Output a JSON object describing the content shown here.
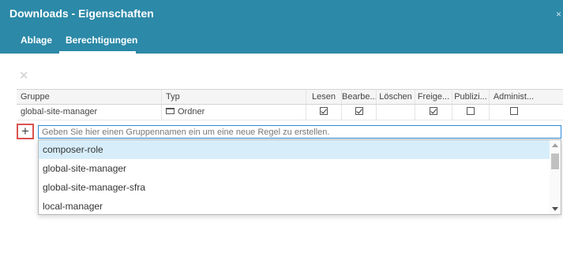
{
  "dialog": {
    "title": "Downloads - Eigenschaften",
    "close_symbol": "×",
    "tabs": [
      {
        "label": "Ablage"
      },
      {
        "label": "Berechtigungen"
      }
    ],
    "active_tab": "Berechtigungen"
  },
  "toolbar": {
    "delete_symbol": "✕"
  },
  "table": {
    "columns": [
      "Gruppe",
      "Typ",
      "Lesen",
      "Bearbe...",
      "Löschen",
      "Freige...",
      "Publizi...",
      "Administ..."
    ],
    "rows": [
      {
        "gruppe": "global-site-manager",
        "typ": "Ordner",
        "typ_icon": "folder-icon",
        "lesen": true,
        "bearbeiten": true,
        "loeschen": null,
        "freigeben": true,
        "publizieren": false,
        "administrieren": false
      }
    ]
  },
  "new_rule": {
    "add_symbol": "+",
    "placeholder": "Geben Sie hier einen Gruppennamen ein um eine neue Regel zu erstellen.",
    "value": ""
  },
  "suggestions": {
    "items": [
      "composer-role",
      "global-site-manager",
      "global-site-manager-sfra",
      "local-manager"
    ],
    "selected_index": 0
  },
  "colors": {
    "header_bg": "#2c89a8",
    "selected_option_bg": "#d7eefa",
    "add_button_border": "#d9534f",
    "input_focus_border": "#2e8bd7"
  }
}
